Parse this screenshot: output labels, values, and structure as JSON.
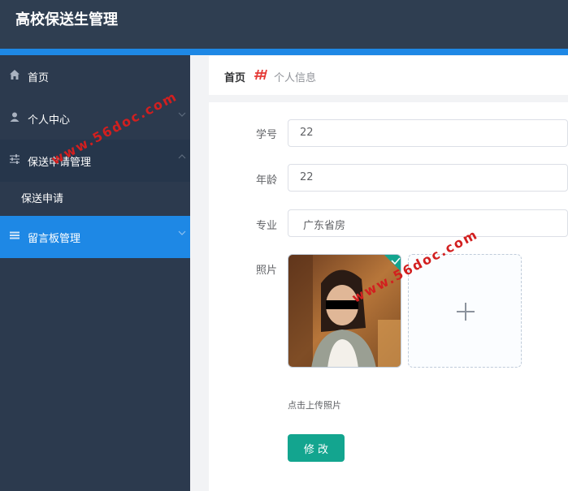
{
  "app": {
    "title": "高校保送生管理"
  },
  "sidebar": {
    "items": [
      {
        "label": "首页",
        "icon": "home-icon"
      },
      {
        "label": "个人中心",
        "icon": "user-icon"
      },
      {
        "label": "保送申请管理",
        "icon": "sliders-icon"
      },
      {
        "label": "保送申请"
      },
      {
        "label": "留言板管理",
        "icon": "list-icon"
      }
    ]
  },
  "breadcrumb": {
    "home": "首页",
    "current": "个人信息"
  },
  "form": {
    "student_id": {
      "label": "学号",
      "value": "22"
    },
    "age": {
      "label": "年龄",
      "value": "22"
    },
    "major": {
      "label": "专业",
      "value": "广东省房"
    },
    "photo": {
      "label": "照片",
      "hint": "点击上传照片"
    },
    "submit_label": "修 改"
  },
  "watermark": "www.56doc.com",
  "colors": {
    "topbar": "#2f3e51",
    "accent": "#1e88e5",
    "sidebar": "#2c3a4e",
    "submit": "#13a58f"
  }
}
